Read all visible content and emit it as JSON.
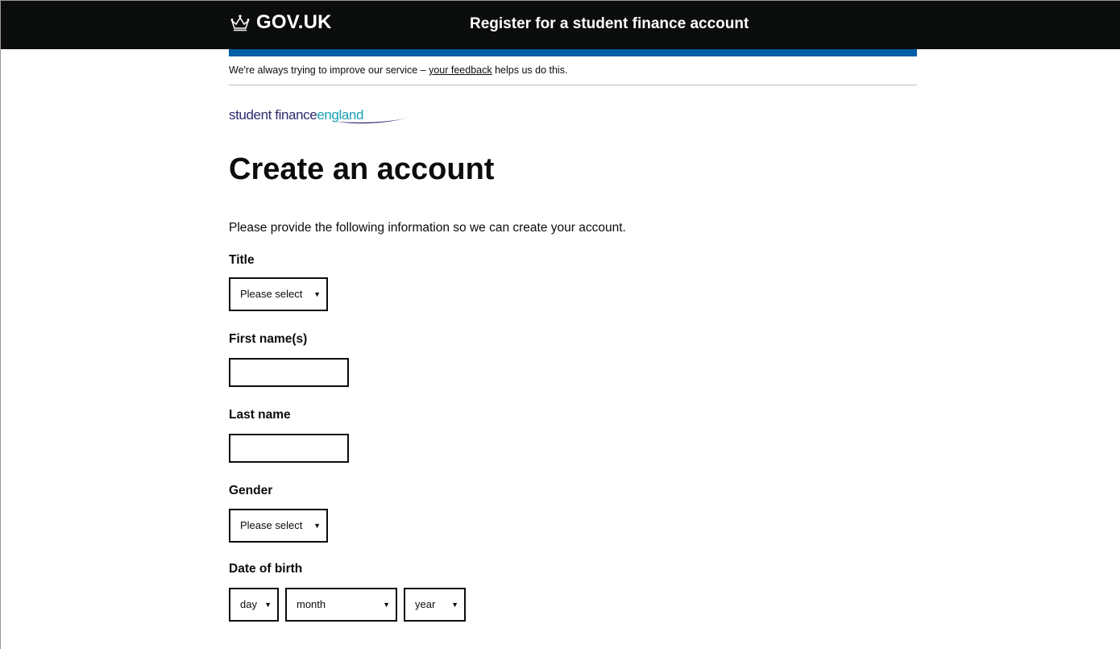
{
  "header": {
    "brand": "GOV.UK",
    "service_name": "Register for a student finance account"
  },
  "feedback": {
    "prefix": "We're always trying to improve our service – ",
    "link": "your feedback",
    "suffix": " helps us do this."
  },
  "logo": {
    "part1": "student finance",
    "part2": "england"
  },
  "page": {
    "title": "Create an account",
    "intro": "Please provide the following information so we can create your account."
  },
  "form": {
    "title": {
      "label": "Title",
      "value": "Please select"
    },
    "first_name": {
      "label": "First name(s)",
      "value": ""
    },
    "last_name": {
      "label": "Last name",
      "value": ""
    },
    "gender": {
      "label": "Gender",
      "value": "Please select"
    },
    "dob": {
      "label": "Date of birth",
      "day": "day",
      "month": "month",
      "year": "year"
    }
  },
  "colors": {
    "header_bg": "#0b0c0c",
    "strip": "#005ea5",
    "logo_primary": "#2d2970",
    "logo_accent": "#1aa0b5"
  },
  "icons": {
    "brand": "crown-icon",
    "select_arrow": "triangle-down-icon"
  }
}
